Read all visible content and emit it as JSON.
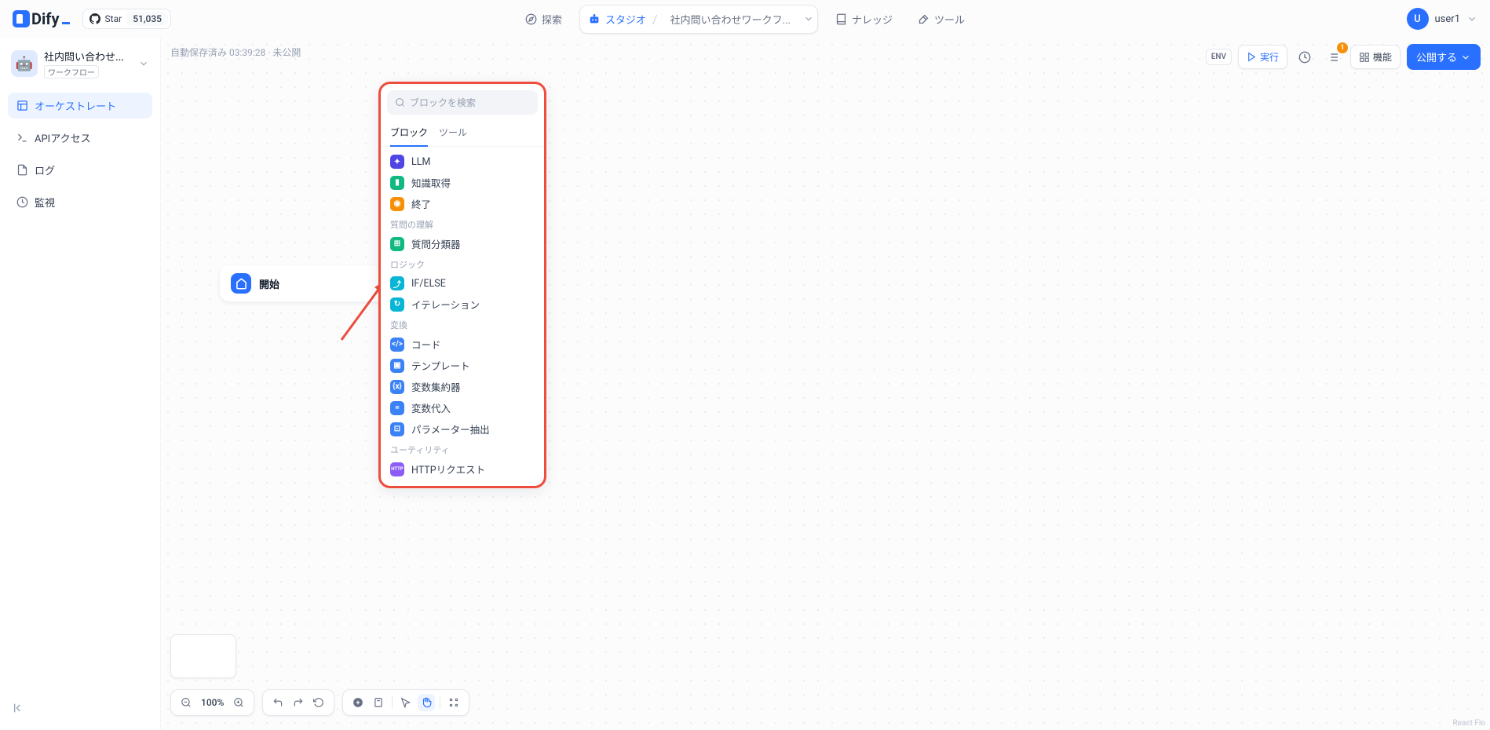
{
  "brand": "Dify",
  "github": {
    "label": "Star",
    "count": "51,035"
  },
  "nav": {
    "explore": "探索",
    "studio": "スタジオ",
    "studio_app": "社内問い合わせワークフ...",
    "knowledge": "ナレッジ",
    "tools": "ツール"
  },
  "user": {
    "initial": "U",
    "name": "user1"
  },
  "app": {
    "name": "社内問い合わせ...",
    "type": "ワークフロー",
    "icon": "🤖"
  },
  "sidebar": {
    "orchestrate": "オーケストレート",
    "api": "APIアクセス",
    "logs": "ログ",
    "monitor": "監視"
  },
  "status": "自動保存済み 03:39:28 · 未公開",
  "toolbar": {
    "env": "ENV",
    "run": "実行",
    "features": "機能",
    "publish": "公開する",
    "badge": "1"
  },
  "node": {
    "start": "開始"
  },
  "popup": {
    "search_placeholder": "ブロックを検索",
    "tab_blocks": "ブロック",
    "tab_tools": "ツール",
    "llm": "LLM",
    "knowledge": "知識取得",
    "end": "終了",
    "g_question": "質問の理解",
    "classifier": "質問分類器",
    "g_logic": "ロジック",
    "ifelse": "IF/ELSE",
    "iteration": "イテレーション",
    "g_transform": "変換",
    "code": "コード",
    "template": "テンプレート",
    "var_agg": "変数集約器",
    "var_assign": "変数代入",
    "param_extract": "パラメーター抽出",
    "g_utility": "ユーティリティ",
    "http": "HTTPリクエスト"
  },
  "zoom": "100%",
  "attribution": "React Flo"
}
